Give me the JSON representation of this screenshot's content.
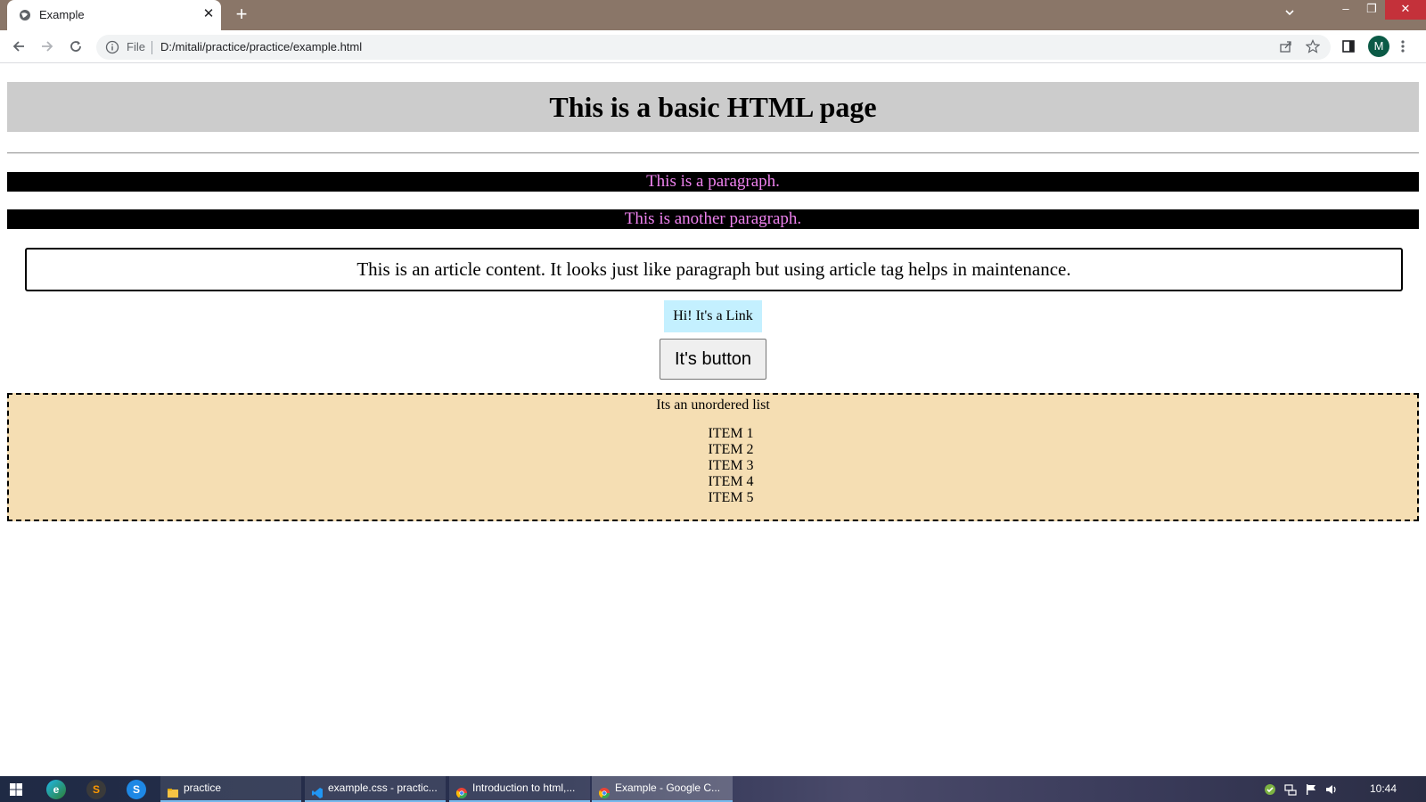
{
  "browser": {
    "tab": {
      "title": "Example"
    },
    "address": {
      "scheme_label": "File",
      "url": "D:/mitali/practice/practice/example.html"
    },
    "profile_initial": "M"
  },
  "page": {
    "heading": "This is a basic HTML page",
    "paragraphs": [
      "This is a paragraph.",
      "This is another paragraph."
    ],
    "article": "This is an article content. It looks just like paragraph but using article tag helps in maintenance.",
    "link": "Hi! It's a Link",
    "button": "It's button",
    "list": {
      "caption": "Its an unordered list",
      "items": [
        "ITEM 1",
        "ITEM 2",
        "ITEM 3",
        "ITEM 4",
        "ITEM 5"
      ]
    }
  },
  "taskbar": {
    "tasks": [
      {
        "label": "practice",
        "icon": "folder-icon"
      },
      {
        "label": "example.css - practic...",
        "icon": "vscode-icon"
      },
      {
        "label": "Introduction to html,...",
        "icon": "chrome-icon"
      },
      {
        "label": "Example - Google C...",
        "icon": "chrome-icon"
      }
    ],
    "clock": "10:44"
  },
  "colors": {
    "heading_bg": "#cccccc",
    "paragraph_bg": "#000000",
    "paragraph_text": "#ee82ee",
    "link_bg": "#c4f0ff",
    "list_bg": "#f5deb3"
  }
}
